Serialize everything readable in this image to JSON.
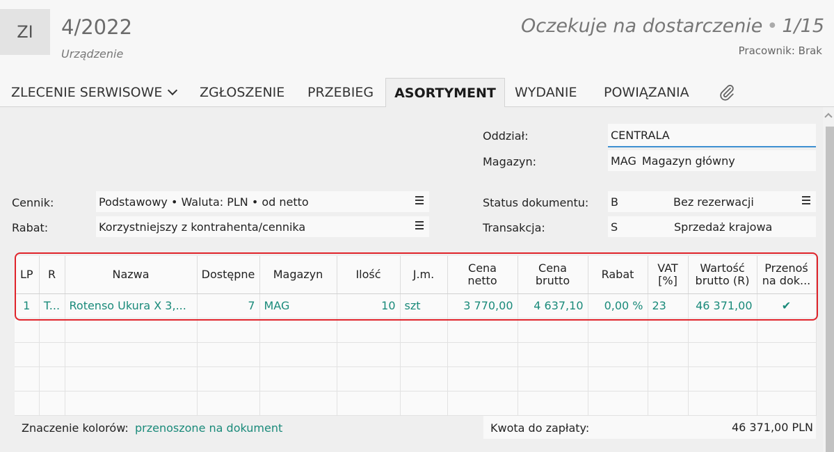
{
  "header": {
    "badge": "ZI",
    "number": "4/2022",
    "type": "Urządzenie",
    "status": "Oczekuje na dostarczenie",
    "separator": "•",
    "page": "1/15",
    "worker": "Pracownik: Brak"
  },
  "tabs": [
    {
      "label": "ZLECENIE SERWISOWE"
    },
    {
      "label": "ZGŁOSZENIE"
    },
    {
      "label": "PRZEBIEG"
    },
    {
      "label": "ASORTYMENT"
    },
    {
      "label": "WYDANIE"
    },
    {
      "label": "POWIĄZANIA"
    }
  ],
  "form": {
    "oddzial_label": "Oddział:",
    "oddzial_value": "CENTRALA",
    "magazyn_label": "Magazyn:",
    "magazyn_code": "MAG",
    "magazyn_name": "Magazyn główny",
    "cennik_label": "Cennik:",
    "cennik_value": "Podstawowy • Waluta: PLN • od netto",
    "rabat_label": "Rabat:",
    "rabat_value": "Korzystniejszy z kontrahenta/cennika",
    "status_label": "Status dokumentu:",
    "status_code": "B",
    "status_name": "Bez rezerwacji",
    "transakcja_label": "Transakcja:",
    "transakcja_code": "S",
    "transakcja_name": "Sprzedaż krajowa"
  },
  "grid": {
    "columns": [
      {
        "l1": "LP",
        "l2": ""
      },
      {
        "l1": "R",
        "l2": ""
      },
      {
        "l1": "Nazwa",
        "l2": ""
      },
      {
        "l1": "Dostępne",
        "l2": ""
      },
      {
        "l1": "Magazyn",
        "l2": ""
      },
      {
        "l1": "Ilość",
        "l2": ""
      },
      {
        "l1": "J.m.",
        "l2": ""
      },
      {
        "l1": "Cena",
        "l2": "netto"
      },
      {
        "l1": "Cena",
        "l2": "brutto"
      },
      {
        "l1": "Rabat",
        "l2": ""
      },
      {
        "l1": "VAT",
        "l2": "[%]"
      },
      {
        "l1": "Wartość",
        "l2": "brutto (R)"
      },
      {
        "l1": "Przenoś",
        "l2": "na dok..."
      }
    ],
    "rows": [
      [
        "1",
        "T...",
        "Rotenso Ukura X 3,...",
        "7",
        "MAG",
        "10",
        "szt",
        "3 770,00",
        "4 637,10",
        "0,00 %",
        "23",
        "46 371,00",
        "✔"
      ]
    ]
  },
  "footer": {
    "legend_label": "Znaczenie kolorów:",
    "legend_value": "przenoszone na dokument",
    "legend_color": "#1a8a7a",
    "total_label": "Kwota do zapłaty:",
    "total_value": "46 371,00 PLN"
  },
  "icons": {
    "attachment": "paperclip-icon",
    "dropdown": "chevron-down-icon",
    "menu": "menu-icon"
  },
  "colors": {
    "accent": "#3d8fd1",
    "highlight": "#e0232a",
    "teal": "#1a8a7a"
  }
}
